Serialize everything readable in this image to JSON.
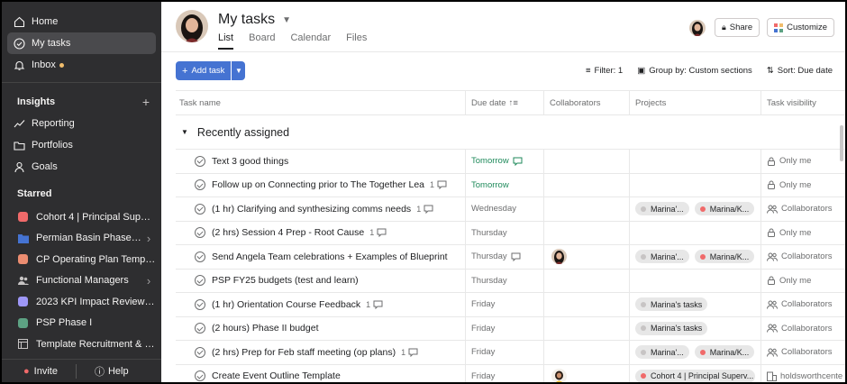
{
  "sidebar": {
    "nav": [
      {
        "label": "Home",
        "icon": "home-icon"
      },
      {
        "label": "My tasks",
        "icon": "check-circle-icon",
        "active": true
      },
      {
        "label": "Inbox",
        "icon": "bell-icon",
        "notify": true
      }
    ],
    "insights": {
      "heading": "Insights",
      "add": "+",
      "items": [
        {
          "label": "Reporting",
          "icon": "line-chart-icon"
        },
        {
          "label": "Portfolios",
          "icon": "folder-icon"
        },
        {
          "label": "Goals",
          "icon": "person-icon"
        }
      ]
    },
    "starred": {
      "heading": "Starred",
      "items": [
        {
          "label": "Cohort 4 | Principal Super...",
          "color": "#f06a6a",
          "kind": "square",
          "chevron": false
        },
        {
          "label": "Permian Basin Phase ...",
          "color": "#4573d2",
          "kind": "folder",
          "chevron": true
        },
        {
          "label": "CP Operating Plan Templa...",
          "color": "#ec8d71",
          "kind": "square",
          "chevron": false
        },
        {
          "label": "Functional Managers",
          "color": "#c7c4c4",
          "kind": "team",
          "chevron": true
        },
        {
          "label": "2023 KPI Impact Review C...",
          "color": "#9e97f7",
          "kind": "square",
          "chevron": false
        },
        {
          "label": "PSP Phase I",
          "color": "#5da283",
          "kind": "square",
          "chevron": false
        },
        {
          "label": "Template Recruitment & S...",
          "color": "#c7c4c4",
          "kind": "template",
          "chevron": false
        }
      ]
    },
    "footer": {
      "invite": "Invite",
      "help": "Help"
    }
  },
  "header": {
    "title": "My tasks",
    "tabs": [
      "List",
      "Board",
      "Calendar",
      "Files"
    ],
    "active_tab": "List",
    "share": "Share",
    "customize": "Customize"
  },
  "toolbar": {
    "add_task": "Add task",
    "filter": "Filter: 1",
    "group": "Group by: Custom sections",
    "sort": "Sort: Due date"
  },
  "columns": [
    "Task name",
    "Due date",
    "Collaborators",
    "Projects",
    "Task visibility"
  ],
  "group": {
    "label": "Recently assigned"
  },
  "tasks": [
    {
      "name": "Text 3 good things",
      "sub": "",
      "due": "Tomorrow",
      "due_green": true,
      "due_comment": true,
      "collab": false,
      "projects": [],
      "vis": "Only me",
      "vis_icon": "lock-icon"
    },
    {
      "name": "Follow up on Connecting prior to The Together Lea",
      "sub": "1",
      "due": "Tomorrow",
      "due_green": true,
      "due_comment": false,
      "collab": false,
      "projects": [],
      "vis": "Only me",
      "vis_icon": "lock-icon"
    },
    {
      "name": "(1 hr) Clarifying and synthesizing comms needs",
      "sub": "1",
      "due": "Wednesday",
      "due_green": false,
      "due_comment": false,
      "collab": false,
      "projects": [
        {
          "label": "Marina'...",
          "color": "#c7c4c4"
        },
        {
          "label": "Marina/K...",
          "color": "#f06a6a"
        }
      ],
      "vis": "Collaborators",
      "vis_icon": "people-icon"
    },
    {
      "name": "(2 hrs) Session 4 Prep - Root Cause",
      "sub": "1",
      "due": "Thursday",
      "due_green": false,
      "due_comment": false,
      "collab": false,
      "projects": [],
      "vis": "Only me",
      "vis_icon": "lock-icon"
    },
    {
      "name": "Send Angela Team celebrations + Examples of Blueprint",
      "sub": "",
      "due": "Thursday",
      "due_green": false,
      "due_comment": true,
      "collab": true,
      "projects": [
        {
          "label": "Marina'...",
          "color": "#c7c4c4"
        },
        {
          "label": "Marina/K...",
          "color": "#f06a6a"
        }
      ],
      "vis": "Collaborators",
      "vis_icon": "people-icon"
    },
    {
      "name": "PSP FY25 budgets (test and learn)",
      "sub": "",
      "due": "Thursday",
      "due_green": false,
      "due_comment": false,
      "collab": false,
      "projects": [],
      "vis": "Only me",
      "vis_icon": "lock-icon"
    },
    {
      "name": "(1 hr) Orientation Course Feedback",
      "sub": "1",
      "due": "Friday",
      "due_green": false,
      "due_comment": false,
      "collab": false,
      "projects": [
        {
          "label": "Marina's tasks",
          "color": "#c7c4c4"
        }
      ],
      "vis": "Collaborators",
      "vis_icon": "people-icon"
    },
    {
      "name": "(2 hours) Phase II budget",
      "sub": "",
      "due": "Friday",
      "due_green": false,
      "due_comment": false,
      "collab": false,
      "projects": [
        {
          "label": "Marina's tasks",
          "color": "#c7c4c4"
        }
      ],
      "vis": "Collaborators",
      "vis_icon": "people-icon"
    },
    {
      "name": "(2 hrs) Prep for Feb staff meeting (op plans)",
      "sub": "1",
      "due": "Friday",
      "due_green": false,
      "due_comment": false,
      "collab": false,
      "projects": [
        {
          "label": "Marina'...",
          "color": "#c7c4c4"
        },
        {
          "label": "Marina/K...",
          "color": "#f06a6a"
        }
      ],
      "vis": "Collaborators",
      "vis_icon": "people-icon"
    },
    {
      "name": "Create Event Outline Template",
      "sub": "",
      "due": "Friday",
      "due_green": false,
      "due_comment": false,
      "collab": true,
      "collab_yellow": true,
      "projects": [
        {
          "label": "Cohort 4 | Principal Superv...",
          "color": "#f06a6a"
        }
      ],
      "vis": "holdsworthcente",
      "vis_icon": "team-icon"
    }
  ]
}
